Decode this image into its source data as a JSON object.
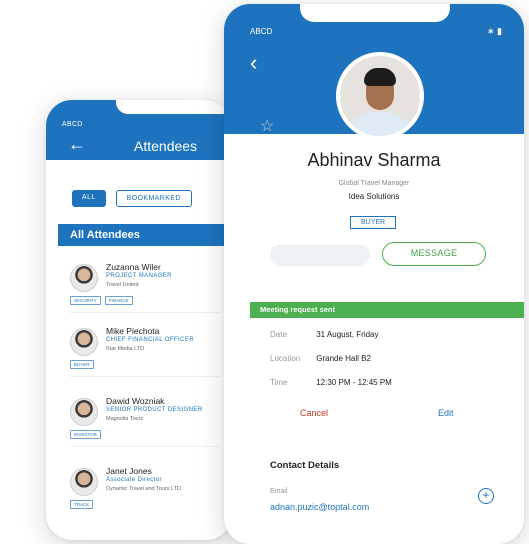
{
  "attendees_screen": {
    "status": "ABCD",
    "back": "←",
    "title": "Attendees",
    "filters": {
      "all": "ALL",
      "bookmarked": "BOOKMARKED"
    },
    "section": "All Attendees",
    "list": [
      {
        "name": "Zuzanna Wiler",
        "role": "PROJECT MANAGER",
        "company": "Travel United",
        "tags": [
          "SECURITY",
          "FINANCE"
        ]
      },
      {
        "name": "Mike Piechota",
        "role": "CHIEF FINANCIAL OFFICER",
        "company": "Star Media LTD",
        "tags": [
          "BUYER"
        ]
      },
      {
        "name": "Dawid Wozniak",
        "role": "SENIOR PRODUCT DESIGNER",
        "company": "Magnolia Tours",
        "tags": [
          "INVESTOR"
        ]
      },
      {
        "name": "Janet Jones",
        "role": "Associate Director",
        "company": "Dynamic Travel and Tours LTD",
        "tags": [
          "TRACK"
        ]
      }
    ]
  },
  "profile_screen": {
    "status": "ABCD",
    "status_right": "∗ ▮",
    "back": "‹",
    "star": "☆",
    "name": "Abhinav Sharma",
    "title": "Global Travel Manager",
    "company": "Idea Solutions",
    "badge": "BUYER",
    "message_button": "MESSAGE",
    "meeting_banner": "Meeting request sent",
    "meeting": [
      {
        "label": "Date",
        "value": "31 August, Friday"
      },
      {
        "label": "Location",
        "value": "Grande Hall B2"
      },
      {
        "label": "Time",
        "value": "12:30 PM - 12:45 PM"
      }
    ],
    "cancel": "Cancel",
    "edit": "Edit",
    "contact_heading": "Contact Details",
    "email_label": "Email",
    "email": "adnan.puzic@toptal.com",
    "add": "+"
  },
  "colors": {
    "primary": "#1e73be",
    "success": "#4caf50",
    "danger": "#c0392b"
  }
}
